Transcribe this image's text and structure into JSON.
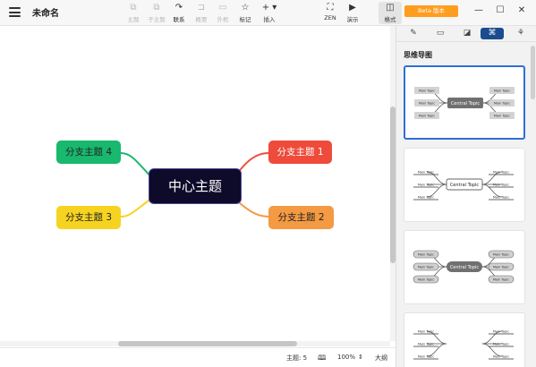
{
  "app": {
    "title": "未命名"
  },
  "toolbar": {
    "tools": [
      {
        "id": "topic",
        "label": "主题",
        "icon": "topic-icon",
        "glyph": "⧉"
      },
      {
        "id": "subtopic",
        "label": "子主题",
        "icon": "subtopic-icon",
        "glyph": "⧉"
      },
      {
        "id": "relationship",
        "label": "联系",
        "icon": "relationship-icon",
        "glyph": "↷"
      },
      {
        "id": "boundary",
        "label": "概要",
        "icon": "boundary-icon",
        "glyph": "⊐"
      },
      {
        "id": "summary",
        "label": "外框",
        "icon": "summary-icon",
        "glyph": "▭"
      },
      {
        "id": "marker",
        "label": "标记",
        "icon": "star-icon",
        "glyph": "☆"
      },
      {
        "id": "insert",
        "label": "插入",
        "icon": "plus-icon",
        "glyph": "+ ▾"
      },
      {
        "id": "zen",
        "label": "ZEN",
        "icon": "zen-icon",
        "glyph": "⛶"
      },
      {
        "id": "present",
        "label": "演示",
        "icon": "present-icon",
        "glyph": "▶"
      },
      {
        "id": "format",
        "label": "格式",
        "icon": "format-icon",
        "glyph": "◫"
      }
    ],
    "beta_label": "Beta 版本"
  },
  "window": {
    "minimize": "—",
    "maximize": "☐",
    "close": "✕"
  },
  "mindmap": {
    "central": "中心主题",
    "branches": [
      {
        "id": "b1",
        "label": "分支主题 1",
        "color": "#ee4b3b"
      },
      {
        "id": "b2",
        "label": "分支主题 2",
        "color": "#f39a43"
      },
      {
        "id": "b3",
        "label": "分支主题 3",
        "color": "#f6d321"
      },
      {
        "id": "b4",
        "label": "分支主题 4",
        "color": "#18b86e"
      }
    ]
  },
  "statusbar": {
    "topic_count": "主题: 5",
    "zoom": "100%",
    "zoom_label": "大纲"
  },
  "panel": {
    "tabs": [
      "brush-icon",
      "tag-icon",
      "note-icon",
      "theme-icon",
      "palette-icon"
    ],
    "section_title": "思维导图",
    "templates": [
      {
        "central": "Central Topic",
        "branch": "Main Topic",
        "style": "grey-box"
      },
      {
        "central": "Central Topic",
        "branch": "Main Topic",
        "style": "underline"
      },
      {
        "central": "Central Topic",
        "branch": "Main Topic",
        "style": "pill"
      },
      {
        "central": "",
        "branch": "Main Topic",
        "style": "underline"
      }
    ]
  }
}
